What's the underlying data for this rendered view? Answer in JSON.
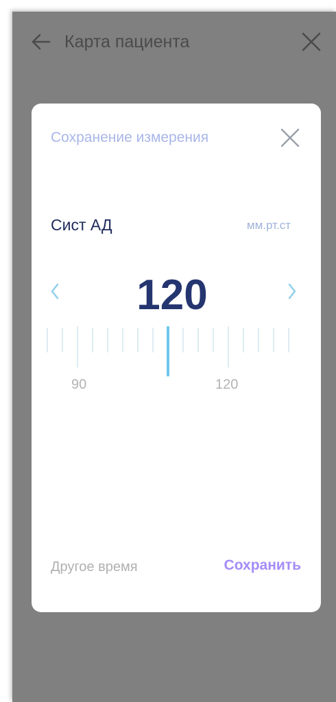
{
  "app": {
    "title": "Карта пациента"
  },
  "dialog": {
    "title": "Сохранение измерения",
    "parameter_name": "Сист АД",
    "unit": "мм.рт.ст",
    "value": "120",
    "ruler": {
      "min_label": "90",
      "current_label": "120",
      "selected_value": 120
    },
    "other_time_label": "Другое время",
    "save_label": "Сохранить"
  },
  "icons": {
    "back": "arrow-left-icon",
    "close": "close-icon",
    "dialog_close": "close-icon",
    "decrement": "chevron-left-icon",
    "increment": "chevron-right-icon"
  },
  "colors": {
    "overlay": "#808080",
    "dialog_title": "#a9b6e8",
    "value": "#253570",
    "accent": "#a48cf7",
    "ruler_indicator": "#6ec6e8",
    "ruler_ticks": "#d9ecf3"
  }
}
